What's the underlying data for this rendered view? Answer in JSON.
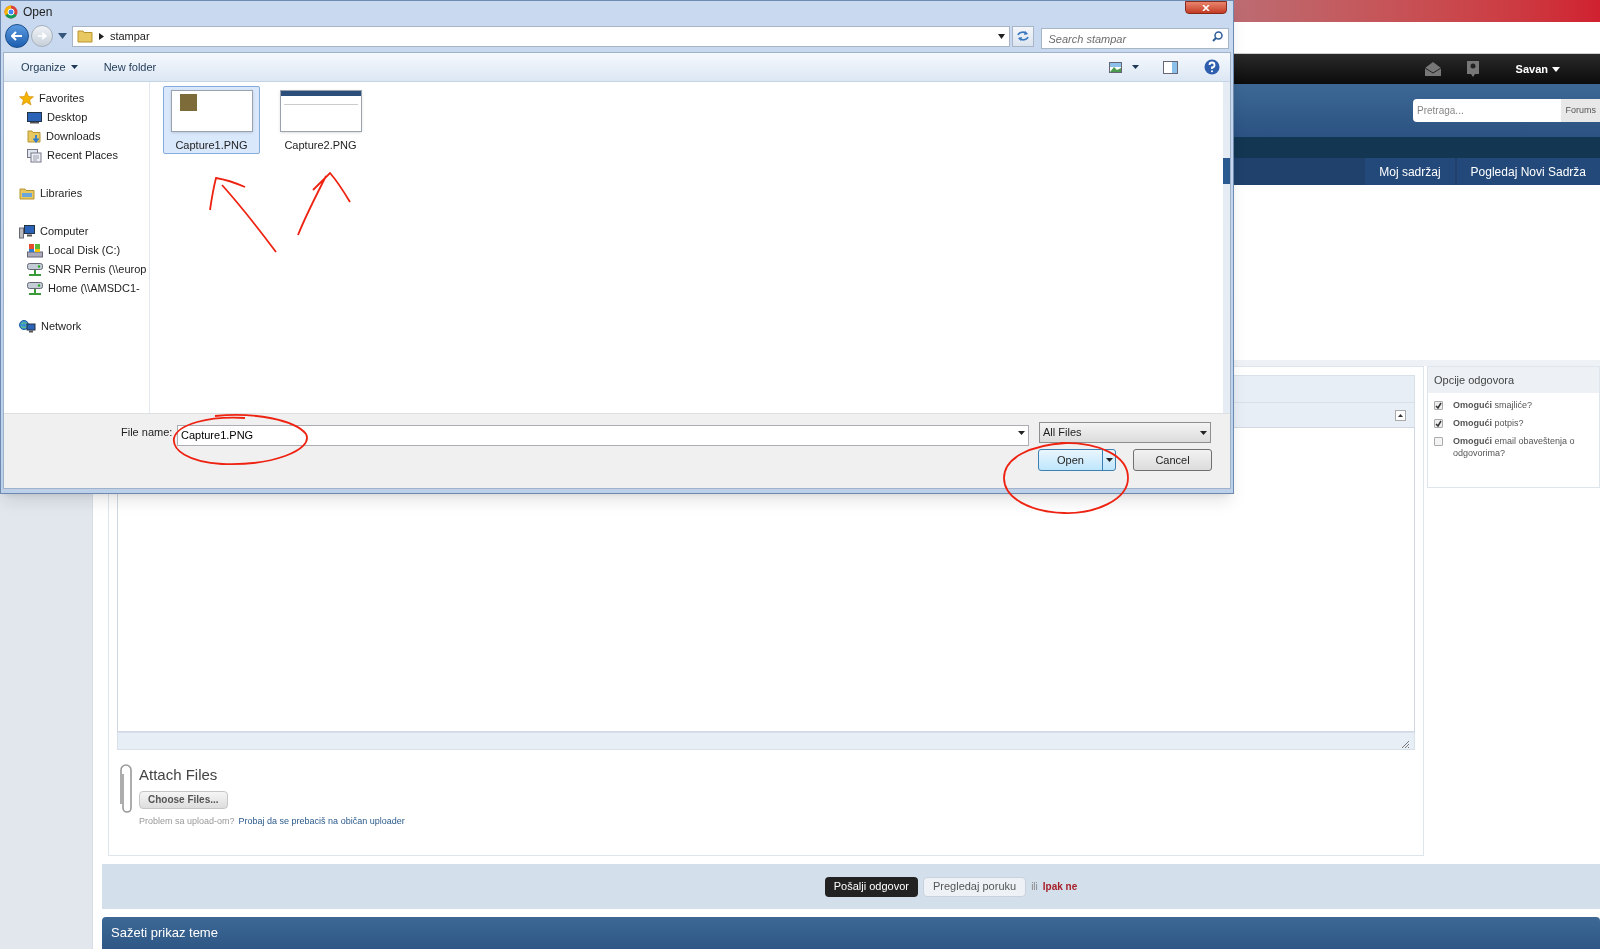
{
  "dialog": {
    "title": "Open",
    "path": [
      "stampar"
    ],
    "search": {
      "placeholder": "Search stampar"
    },
    "toolbar": [
      "Organize",
      "New folder"
    ],
    "nav": [
      {
        "label": "Favorites",
        "kind": "star",
        "children": [
          {
            "label": "Desktop",
            "kind": "desktop"
          },
          {
            "label": "Downloads",
            "kind": "downloads"
          },
          {
            "label": "Recent Places",
            "kind": "recent"
          }
        ]
      },
      {
        "label": "Libraries",
        "kind": "library"
      },
      {
        "label": "Computer",
        "kind": "computer",
        "children": [
          {
            "label": "Local Disk (C:)",
            "kind": "disk"
          },
          {
            "label": "SNR Pernis (\\\\europ",
            "kind": "netdrive"
          },
          {
            "label": "Home (\\\\AMSDC1-",
            "kind": "netdrive"
          }
        ]
      },
      {
        "label": "Network",
        "kind": "network"
      }
    ],
    "files": [
      {
        "name": "Capture1.PNG",
        "selected": true
      },
      {
        "name": "Capture2.PNG",
        "selected": false
      }
    ],
    "file_name": {
      "label": "File name:",
      "value": "Capture1.PNG"
    },
    "filter": "All Files",
    "buttons": [
      {
        "label": "Open",
        "kind": "split"
      },
      {
        "label": "Cancel",
        "kind": "plain"
      }
    ]
  },
  "page": {
    "user": "Savan",
    "search": {
      "placeholder": "Pretraga...",
      "scope": "Forums"
    },
    "nav": [
      "Moj sadržaj",
      "Pogledaj Novi Sadrža"
    ],
    "options": {
      "title": "Opcije odgovora",
      "items": [
        {
          "text": "**Omogući** smajliće?",
          "checked": true
        },
        {
          "text": "**Omogući** potpis?",
          "checked": true
        },
        {
          "text": "**Omogući** email obaveštenja o odgovorima?",
          "checked": false
        }
      ]
    },
    "attach": {
      "title": "Attach Files",
      "button": "Choose Files...",
      "help": "Problem sa upload-om?",
      "link": "Probaj da se prebaciš na običan uploader"
    },
    "actions": {
      "submit": "Pošalji odgovor",
      "preview": "Pregledaj poruku",
      "or": "ili",
      "cancel": "Ipak ne"
    },
    "section": "Sažeti prikaz teme"
  }
}
